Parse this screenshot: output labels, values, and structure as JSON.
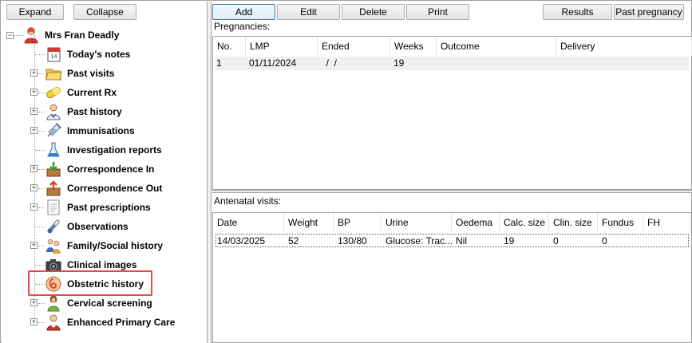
{
  "toolbar_left": {
    "expand_label": "Expand",
    "collapse_label": "Collapse"
  },
  "toolbar_right": {
    "add_label": "Add",
    "edit_label": "Edit",
    "delete_label": "Delete",
    "print_label": "Print",
    "results_label": "Results",
    "past_pregnancy_label": "Past pregnancy"
  },
  "tree": {
    "root_label": "Mrs Fran Deadly",
    "items": [
      {
        "label": "Today's notes",
        "icon": "calendar-notes-icon",
        "expandable": false
      },
      {
        "label": "Past visits",
        "icon": "folder-icon",
        "expandable": true
      },
      {
        "label": "Current Rx",
        "icon": "pill-capsule-icon",
        "expandable": true
      },
      {
        "label": "Past history",
        "icon": "doctor-icon",
        "expandable": true
      },
      {
        "label": "Immunisations",
        "icon": "syringe-icon",
        "expandable": true
      },
      {
        "label": "Investigation reports",
        "icon": "flask-icon",
        "expandable": false
      },
      {
        "label": "Correspondence In",
        "icon": "inbox-download-icon",
        "expandable": true
      },
      {
        "label": "Correspondence Out",
        "icon": "outbox-upload-icon",
        "expandable": true
      },
      {
        "label": "Past prescriptions",
        "icon": "prescription-icon",
        "expandable": true
      },
      {
        "label": "Observations",
        "icon": "thermometer-icon",
        "expandable": false
      },
      {
        "label": "Family/Social history",
        "icon": "family-icon",
        "expandable": true
      },
      {
        "label": "Clinical images",
        "icon": "camera-icon",
        "expandable": false
      },
      {
        "label": "Obstetric history",
        "icon": "fetus-icon",
        "expandable": false
      },
      {
        "label": "Cervical screening",
        "icon": "woman-icon",
        "expandable": true
      },
      {
        "label": "Enhanced Primary Care",
        "icon": "care-team-icon",
        "expandable": true
      }
    ]
  },
  "pregnancies": {
    "section_label": "Pregnancies:",
    "columns": [
      "No.",
      "LMP",
      "Ended",
      "Weeks",
      "Outcome",
      "Delivery"
    ],
    "rows": [
      [
        "1",
        "01/11/2024",
        "  /  /",
        "19",
        "",
        ""
      ]
    ]
  },
  "antenatal": {
    "section_label": "Antenatal visits:",
    "columns": [
      "Date",
      "Weight",
      "BP",
      "Urine",
      "Oedema",
      "Calc. size",
      "Clin. size",
      "Fundus",
      "FH"
    ],
    "rows": [
      [
        "14/03/2025",
        "52",
        "130/80",
        "Glucose: Trac...",
        "Nil",
        "19",
        "0",
        "0",
        ""
      ]
    ]
  },
  "colors": {
    "highlight_border": "#e04848",
    "selected_row": "#f0f0f0"
  }
}
